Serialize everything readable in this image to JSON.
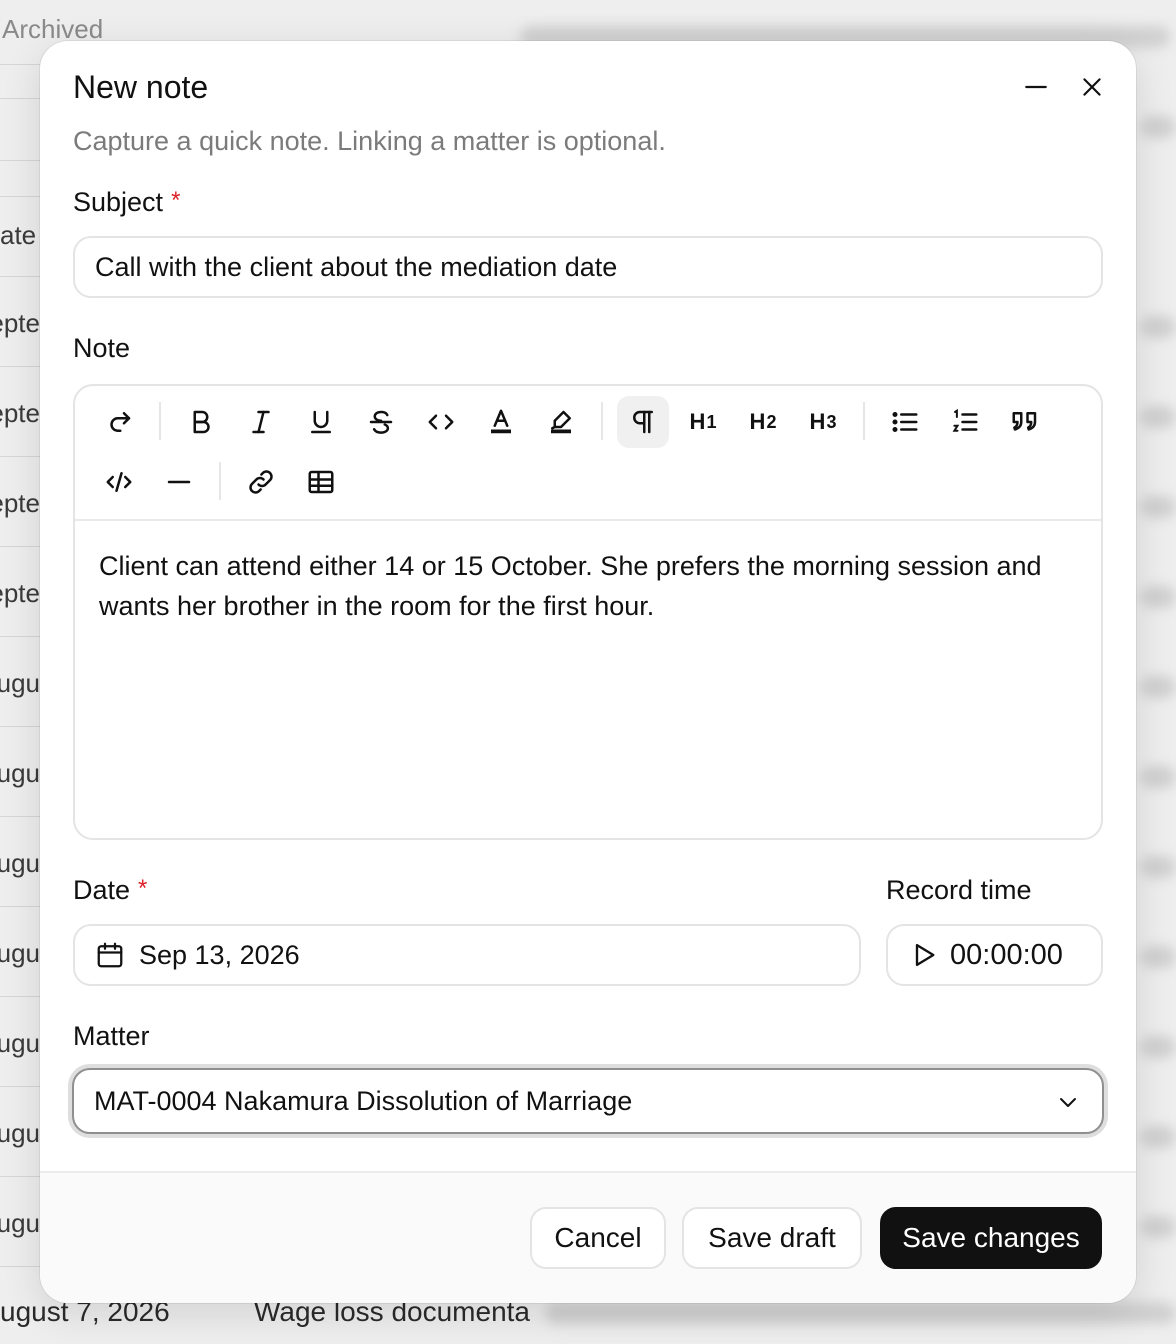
{
  "background": {
    "archived_label": "Archived",
    "row_snippets": [
      "ate",
      "epte",
      "epte",
      "epte",
      "epte",
      "ugu",
      "ugu",
      "ugu",
      "ugu",
      "ugu",
      "ugu",
      "ugu"
    ],
    "bottom_date": "ugust 7, 2026",
    "bottom_description": "Wage loss documenta"
  },
  "modal": {
    "title": "New note",
    "subtitle": "Capture a quick note. Linking a matter is optional.",
    "subject": {
      "label": "Subject",
      "required_mark": "*",
      "value": "Call with the client about the mediation date"
    },
    "note": {
      "label": "Note",
      "toolbar": {
        "heading1": "H",
        "heading1_sub": "1",
        "heading2": "H",
        "heading2_sub": "2",
        "heading3": "H",
        "heading3_sub": "3"
      },
      "content": "Client can attend either 14 or 15 October. She prefers the morning session and wants her brother in the room for the first hour."
    },
    "date": {
      "label": "Date",
      "required_mark": "*",
      "value": "Sep 13, 2026"
    },
    "record_time": {
      "label": "Record time",
      "value": "00:00:00"
    },
    "matter": {
      "label": "Matter",
      "value": "MAT-0004 Nakamura Dissolution of Marriage"
    },
    "footer": {
      "cancel": "Cancel",
      "save_draft": "Save draft",
      "save_changes": "Save changes"
    }
  }
}
